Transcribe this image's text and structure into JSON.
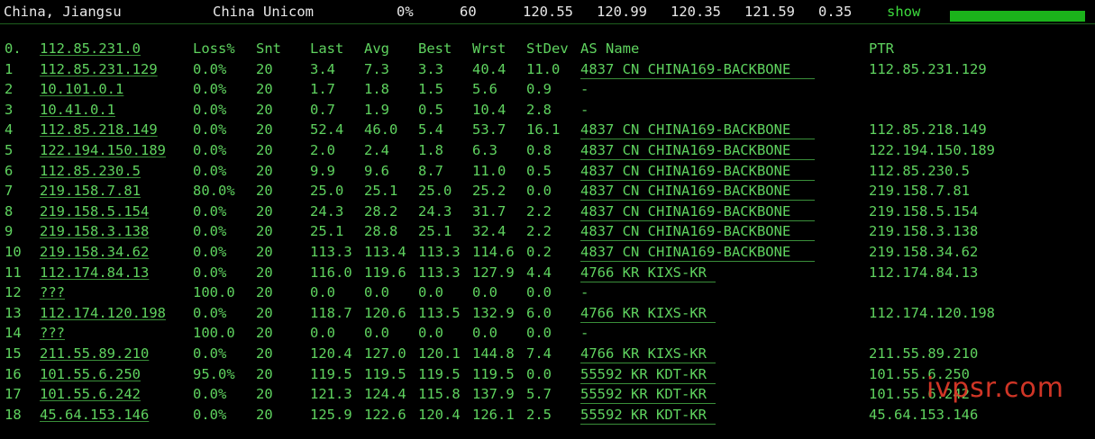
{
  "header": {
    "location": "China, Jiangsu",
    "isp": "China Unicom",
    "loss": "0%",
    "count": "60",
    "stat1": "120.55",
    "stat2": "120.99",
    "stat3": "120.35",
    "stat4": "121.59",
    "stat5": "0.35",
    "show_label": "show",
    "bar_fill": 1.0
  },
  "columns": {
    "hop": "0.",
    "host": "112.85.231.0",
    "loss": "Loss%",
    "snt": "Snt",
    "last": "Last",
    "avg": "Avg",
    "best": "Best",
    "wrst": "Wrst",
    "stdev": "StDev",
    "as": "AS Name",
    "ptr": "PTR"
  },
  "rows": [
    {
      "hop": "1",
      "host": "112.85.231.129",
      "loss": "0.0%",
      "snt": "20",
      "last": "3.4",
      "avg": "7.3",
      "best": "3.3",
      "wrst": "40.4",
      "stdev": "11.0",
      "as": "4837  CN CHINA169-BACKBONE",
      "ptr": "112.85.231.129"
    },
    {
      "hop": "2",
      "host": "10.101.0.1",
      "loss": "0.0%",
      "snt": "20",
      "last": "1.7",
      "avg": "1.8",
      "best": "1.5",
      "wrst": "5.6",
      "stdev": "0.9",
      "as": "-",
      "ptr": ""
    },
    {
      "hop": "3",
      "host": "10.41.0.1",
      "loss": "0.0%",
      "snt": "20",
      "last": "0.7",
      "avg": "1.9",
      "best": "0.5",
      "wrst": "10.4",
      "stdev": "2.8",
      "as": "-",
      "ptr": ""
    },
    {
      "hop": "4",
      "host": "112.85.218.149",
      "loss": "0.0%",
      "snt": "20",
      "last": "52.4",
      "avg": "46.0",
      "best": "5.4",
      "wrst": "53.7",
      "stdev": "16.1",
      "as": "4837  CN CHINA169-BACKBONE",
      "ptr": "112.85.218.149"
    },
    {
      "hop": "5",
      "host": "122.194.150.189",
      "loss": "0.0%",
      "snt": "20",
      "last": "2.0",
      "avg": "2.4",
      "best": "1.8",
      "wrst": "6.3",
      "stdev": "0.8",
      "as": "4837  CN CHINA169-BACKBONE",
      "ptr": "122.194.150.189"
    },
    {
      "hop": "6",
      "host": "112.85.230.5",
      "loss": "0.0%",
      "snt": "20",
      "last": "9.9",
      "avg": "9.6",
      "best": "8.7",
      "wrst": "11.0",
      "stdev": "0.5",
      "as": "4837  CN CHINA169-BACKBONE",
      "ptr": "112.85.230.5"
    },
    {
      "hop": "7",
      "host": "219.158.7.81",
      "loss": "80.0%",
      "snt": "20",
      "last": "25.0",
      "avg": "25.1",
      "best": "25.0",
      "wrst": "25.2",
      "stdev": "0.0",
      "as": "4837  CN CHINA169-BACKBONE",
      "ptr": "219.158.7.81"
    },
    {
      "hop": "8",
      "host": "219.158.5.154",
      "loss": "0.0%",
      "snt": "20",
      "last": "24.3",
      "avg": "28.2",
      "best": "24.3",
      "wrst": "31.7",
      "stdev": "2.2",
      "as": "4837  CN CHINA169-BACKBONE",
      "ptr": "219.158.5.154"
    },
    {
      "hop": "9",
      "host": "219.158.3.138",
      "loss": "0.0%",
      "snt": "20",
      "last": "25.1",
      "avg": "28.8",
      "best": "25.1",
      "wrst": "32.4",
      "stdev": "2.2",
      "as": "4837  CN CHINA169-BACKBONE",
      "ptr": "219.158.3.138"
    },
    {
      "hop": "10",
      "host": "219.158.34.62",
      "loss": "0.0%",
      "snt": "20",
      "last": "113.3",
      "avg": "113.4",
      "best": "113.3",
      "wrst": "114.6",
      "stdev": "0.2",
      "as": "4837  CN CHINA169-BACKBONE",
      "ptr": "219.158.34.62"
    },
    {
      "hop": "11",
      "host": "112.174.84.13",
      "loss": "0.0%",
      "snt": "20",
      "last": "116.0",
      "avg": "119.6",
      "best": "113.3",
      "wrst": "127.9",
      "stdev": "4.4",
      "as": "4766  KR KIXS-KR",
      "ptr": "112.174.84.13"
    },
    {
      "hop": "12",
      "host": "???",
      "loss": "100.0",
      "snt": "20",
      "last": "0.0",
      "avg": "0.0",
      "best": "0.0",
      "wrst": "0.0",
      "stdev": "0.0",
      "as": "-",
      "ptr": ""
    },
    {
      "hop": "13",
      "host": "112.174.120.198",
      "loss": "0.0%",
      "snt": "20",
      "last": "118.7",
      "avg": "120.6",
      "best": "113.5",
      "wrst": "132.9",
      "stdev": "6.0",
      "as": "4766  KR KIXS-KR",
      "ptr": "112.174.120.198"
    },
    {
      "hop": "14",
      "host": "???",
      "loss": "100.0",
      "snt": "20",
      "last": "0.0",
      "avg": "0.0",
      "best": "0.0",
      "wrst": "0.0",
      "stdev": "0.0",
      "as": "-",
      "ptr": ""
    },
    {
      "hop": "15",
      "host": "211.55.89.210",
      "loss": "0.0%",
      "snt": "20",
      "last": "120.4",
      "avg": "127.0",
      "best": "120.1",
      "wrst": "144.8",
      "stdev": "7.4",
      "as": "4766  KR KIXS-KR",
      "ptr": "211.55.89.210"
    },
    {
      "hop": "16",
      "host": "101.55.6.250",
      "loss": "95.0%",
      "snt": "20",
      "last": "119.5",
      "avg": "119.5",
      "best": "119.5",
      "wrst": "119.5",
      "stdev": "0.0",
      "as": "55592 KR KDT-KR",
      "ptr": "101.55.6.250"
    },
    {
      "hop": "17",
      "host": "101.55.6.242",
      "loss": "0.0%",
      "snt": "20",
      "last": "121.3",
      "avg": "124.4",
      "best": "115.8",
      "wrst": "137.9",
      "stdev": "5.7",
      "as": "55592 KR KDT-KR",
      "ptr": "101.55.6.242"
    },
    {
      "hop": "18",
      "host": "45.64.153.146",
      "loss": "0.0%",
      "snt": "20",
      "last": "125.9",
      "avg": "122.6",
      "best": "120.4",
      "wrst": "126.1",
      "stdev": "2.5",
      "as": "55592 KR KDT-KR",
      "ptr": "45.64.153.146"
    }
  ],
  "watermark": "ivpsr.com",
  "colors": {
    "background": "#000000",
    "text": "#5fd35f",
    "header_text": "#e8e8e8",
    "bar": "#1bb31b",
    "watermark": "#e23a2a"
  }
}
